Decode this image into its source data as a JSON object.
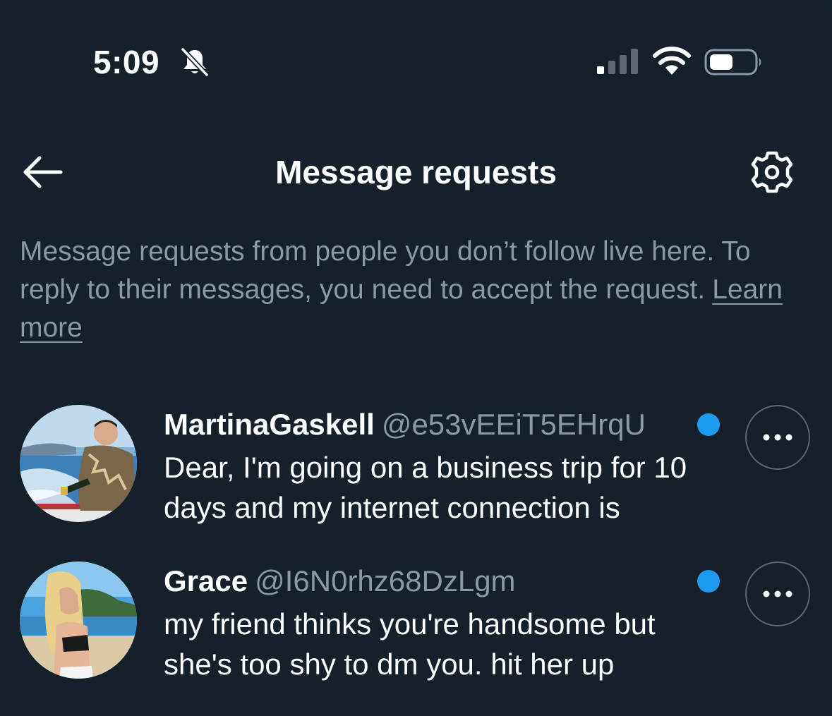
{
  "status_bar": {
    "time": "5:09",
    "icons": [
      "bell-slash-icon",
      "cellular-signal-icon",
      "wifi-icon",
      "battery-icon"
    ]
  },
  "header": {
    "title": "Message requests",
    "back_icon": "arrow-left-icon",
    "settings_icon": "gear-icon"
  },
  "info": {
    "text": "Message requests from people you don’t follow live here. To reply to their messages, you need to accept the request.",
    "link": "Learn more"
  },
  "requests": [
    {
      "name": "MartinaGaskell",
      "handle": "@e53vEEiT5EHrqU",
      "preview": "Dear, I'm going on a business trip for 10 days and my internet connection is",
      "unread": true,
      "menu_icon": "more-horizontal-icon"
    },
    {
      "name": "Grace",
      "handle": "@I6N0rhz68DzLgm",
      "preview": "my friend thinks you're handsome but she's too shy to dm you. hit her up",
      "unread": true,
      "menu_icon": "more-horizontal-icon"
    }
  ],
  "colors": {
    "background": "#15202b",
    "text_primary": "#ffffff",
    "text_secondary": "#8b98a5",
    "accent": "#1d9bf0",
    "border": "#5b6670"
  }
}
